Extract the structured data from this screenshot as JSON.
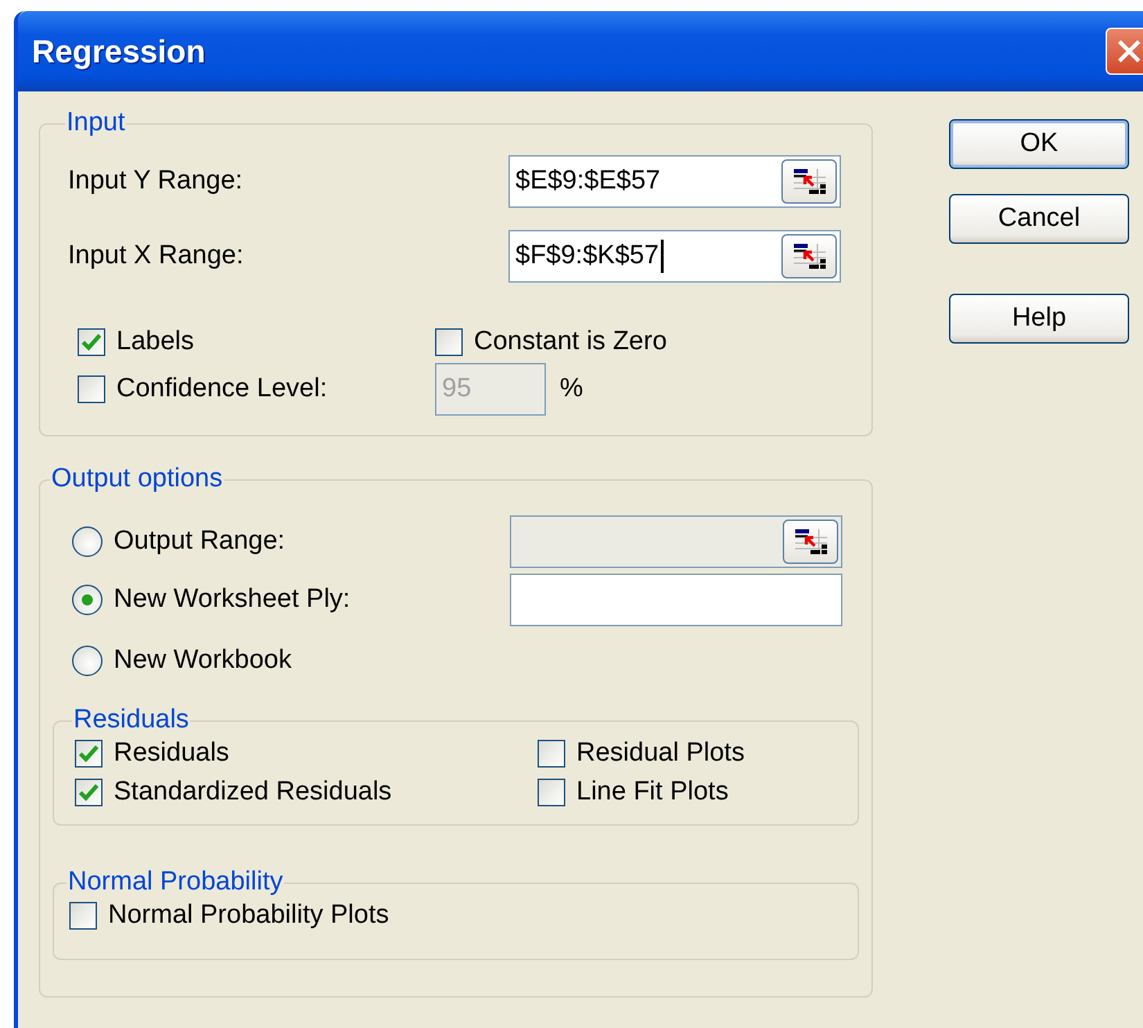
{
  "window": {
    "title": "Regression"
  },
  "input": {
    "legend": "Input",
    "ranges": [
      {
        "label": "Input Y Range:",
        "value": "$E$9:$E$57",
        "caret": false
      },
      {
        "label": "Input X Range:",
        "value": "$F$9:$K$57",
        "caret": true
      }
    ],
    "labels": {
      "label": "Labels",
      "checked": true
    },
    "constant_is_zero": {
      "label": "Constant is Zero",
      "checked": false
    },
    "confidence": {
      "label": "Confidence Level:",
      "checked": false,
      "value": "95",
      "disabled": true,
      "unit": "%"
    }
  },
  "output": {
    "legend": "Output options",
    "choices": [
      {
        "label": "Output Range:",
        "selected": false,
        "field": {
          "disabled": true,
          "picker": true
        }
      },
      {
        "label": "New Worksheet Ply:",
        "selected": true,
        "field": {
          "disabled": false,
          "picker": false
        }
      },
      {
        "label": "New Workbook",
        "selected": false
      }
    ],
    "residuals": {
      "legend": "Residuals",
      "options": [
        {
          "label": "Residuals",
          "checked": true
        },
        {
          "label": "Residual Plots",
          "checked": false
        },
        {
          "label": "Standardized Residuals",
          "checked": true
        },
        {
          "label": "Line Fit Plots",
          "checked": false
        }
      ]
    },
    "normal_probability": {
      "legend": "Normal Probability",
      "options": [
        {
          "label": "Normal Probability Plots",
          "checked": false
        }
      ]
    }
  },
  "buttons": [
    {
      "label": "OK",
      "default": true
    },
    {
      "label": "Cancel",
      "default": false
    },
    {
      "label": "Help",
      "default": false
    }
  ]
}
